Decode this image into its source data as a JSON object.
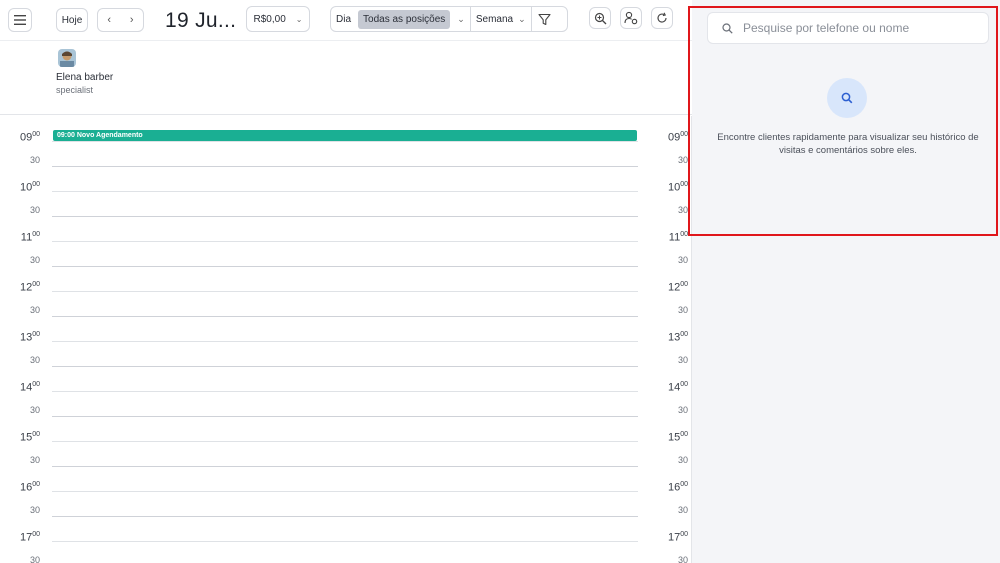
{
  "toolbar": {
    "today_label": "Hoje",
    "prev_symbol": "‹",
    "next_symbol": "›",
    "date_title": "19 Ju...",
    "amount": "R$0,00",
    "view_day": "Dia",
    "view_positions": "Todas as posições",
    "view_week": "Semana"
  },
  "staff": {
    "name": "Elena barber",
    "role": "specialist"
  },
  "event": {
    "label": "09:00 Novo Agendamento",
    "color": "#1aaf93"
  },
  "times": [
    {
      "hour": "09",
      "min": "00"
    },
    {
      "hour": "10",
      "min": "00"
    },
    {
      "hour": "11",
      "min": "00"
    },
    {
      "hour": "12",
      "min": "00"
    },
    {
      "hour": "13",
      "min": "00"
    },
    {
      "hour": "14",
      "min": "00"
    },
    {
      "hour": "15",
      "min": "00"
    },
    {
      "hour": "16",
      "min": "00"
    },
    {
      "hour": "17",
      "min": "00"
    }
  ],
  "half_label": "30",
  "side": {
    "search_placeholder": "Pesquise por telefone ou nome",
    "message": "Encontre clientes rapidamente para visualizar seu histórico de visitas e comentários sobre eles."
  },
  "colors": {
    "accent": "#1aaf93",
    "highlight_border": "#e0161b",
    "panel_bg": "#f4f5f8",
    "search_circle": "#d8e6fb"
  }
}
